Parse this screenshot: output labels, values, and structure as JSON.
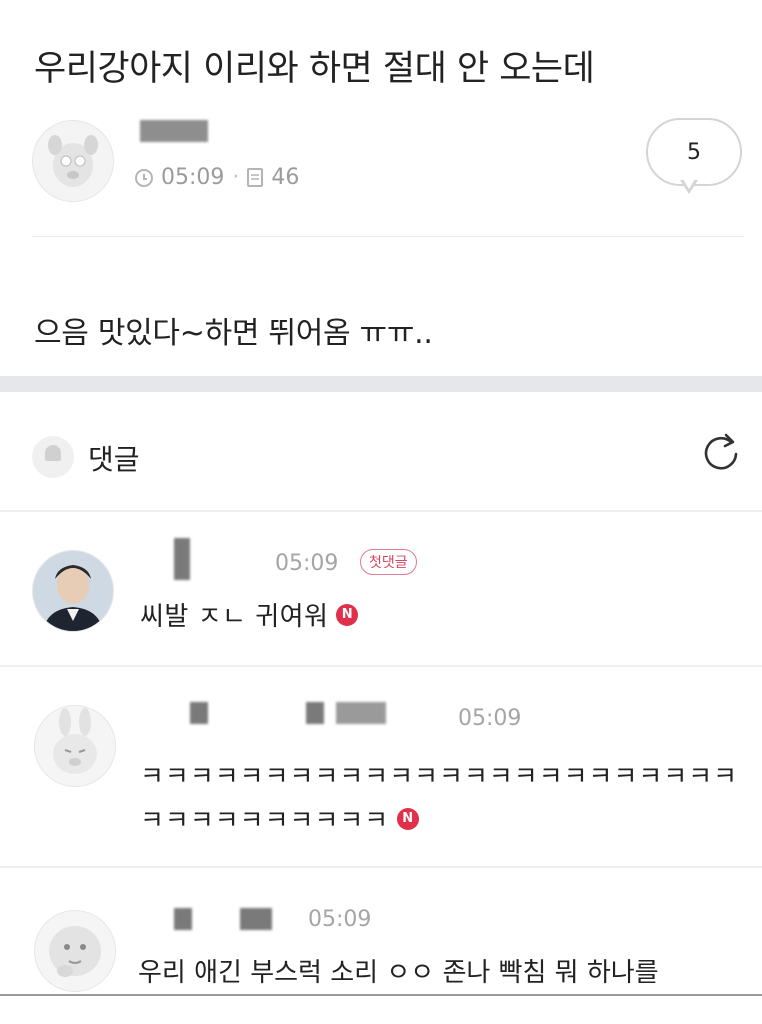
{
  "post": {
    "title": "우리강아지 이리와 하면 절대 안 오는데",
    "time": "05:09",
    "views": "46",
    "comment_count": "5",
    "body": "으음 맛있다~하면 뛰어옴 ㅠㅠ.."
  },
  "comments_section": {
    "label": "댓글"
  },
  "comments": [
    {
      "time": "05:09",
      "badge": "첫댓글",
      "text": "씨발 ㅈㄴ 귀여워",
      "new_badge": "N"
    },
    {
      "time": "05:09",
      "text_line1": "ㅋㅋㅋㅋㅋㅋㅋㅋㅋㅋㅋㅋㅋㅋㅋㅋㅋㅋㅋㅋㅋㅋㅋㅋ",
      "text_line2": "ㅋㅋㅋㅋㅋㅋㅋㅋㅋㅋ",
      "new_badge": "N"
    },
    {
      "time": "05:09",
      "text": "우리 애긴 부스럭 소리 ㅇㅇ 존나 빡침 뭐 하나를"
    }
  ],
  "colors": {
    "new_badge": "#e0304a",
    "first_badge": "#d5475f",
    "section_gap": "#e6e7ea"
  }
}
